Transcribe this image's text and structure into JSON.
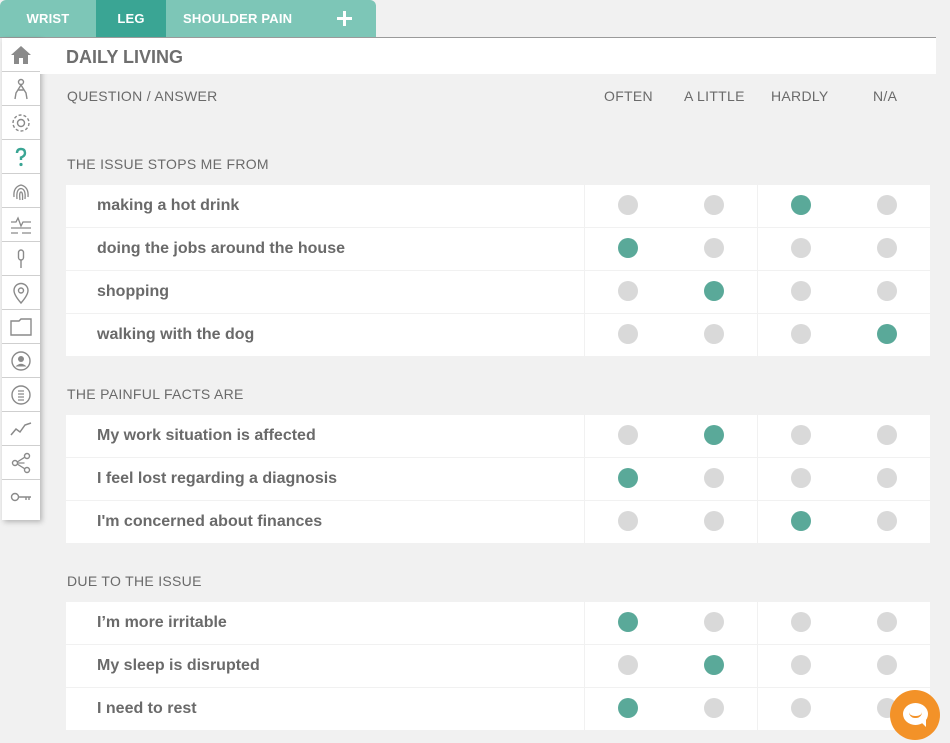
{
  "tabs": [
    {
      "label": "WRIST"
    },
    {
      "label": "LEG"
    },
    {
      "label": "SHOULDER PAIN"
    }
  ],
  "sidebar": {
    "items": [
      "home-icon",
      "body-icon",
      "gear-icon",
      "help-icon",
      "fingerprint-icon",
      "signal-icon",
      "microphone-icon",
      "location-pin-icon",
      "folder-icon",
      "profile-icon",
      "list-icon",
      "trend-icon",
      "share-icon",
      "key-icon"
    ]
  },
  "page": {
    "title": "DAILY LIVING"
  },
  "columns": {
    "question": "QUESTION / ANSWER",
    "answers": [
      "OFTEN",
      "A LITTLE",
      "HARDLY",
      "N/A"
    ]
  },
  "sections": [
    {
      "title": "THE ISSUE STOPS ME FROM",
      "rows": [
        {
          "question": "making a hot drink",
          "selected": 2
        },
        {
          "question": "doing the jobs around the house",
          "selected": 0
        },
        {
          "question": "shopping",
          "selected": 1
        },
        {
          "question": "walking with the dog",
          "selected": 3
        }
      ]
    },
    {
      "title": "THE PAINFUL FACTS ARE",
      "rows": [
        {
          "question": "My work situation is affected",
          "selected": 1
        },
        {
          "question": "I feel lost regarding a diagnosis",
          "selected": 0
        },
        {
          "question": "I'm concerned about finances",
          "selected": 2
        }
      ]
    },
    {
      "title": "DUE TO THE ISSUE",
      "rows": [
        {
          "question": "I’m more irritable",
          "selected": 0
        },
        {
          "question": "My sleep is disrupted",
          "selected": 1
        },
        {
          "question": "I need to rest",
          "selected": 0
        }
      ]
    }
  ],
  "colors": {
    "accent": "#3aa594",
    "tab_light": "#7dc6b7",
    "selected_dot": "#5aa999",
    "unselected_dot": "#d9d9d9",
    "chat": "#f39228"
  }
}
